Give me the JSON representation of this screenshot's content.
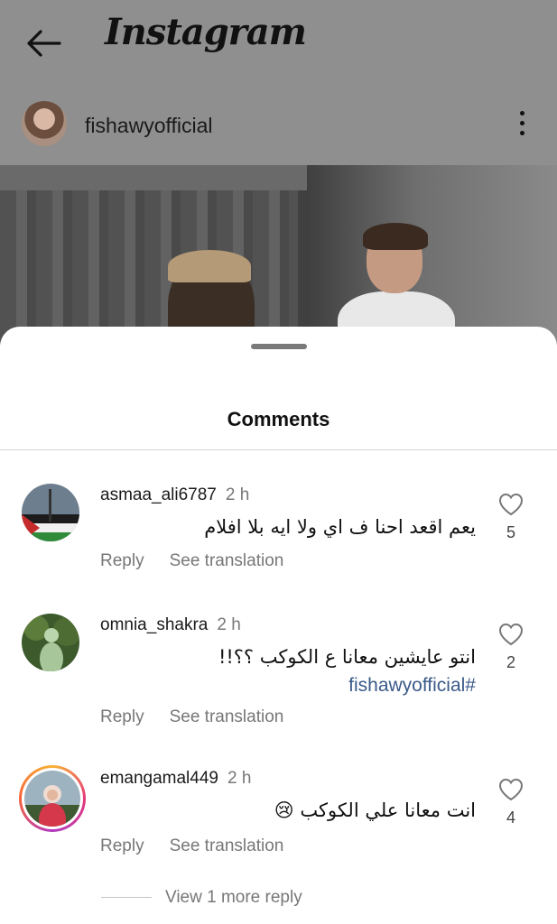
{
  "app": {
    "title": "Instagram"
  },
  "post": {
    "username": "fishawyofficial"
  },
  "sheet": {
    "title": "Comments"
  },
  "comments": [
    {
      "username": "asmaa_ali6787",
      "time": "2 h",
      "text": "يعم اقعد احنا ف اي ولا ايه بلا افلام",
      "tag": "",
      "likes": "5",
      "reply": "Reply",
      "translate": "See translation"
    },
    {
      "username": "omnia_shakra",
      "time": "2 h",
      "text": "انتو عايشين معانا ع الكوكب ؟؟!!",
      "tag": "fishawyofficial#",
      "likes": "2",
      "reply": "Reply",
      "translate": "See translation"
    },
    {
      "username": "emangamal449",
      "time": "2 h",
      "text": "انت معانا علي الكوكب 😢",
      "tag": "",
      "likes": "4",
      "reply": "Reply",
      "translate": "See translation"
    }
  ],
  "view_more": "View 1 more reply",
  "icons": [
    "back-arrow-icon",
    "more-options-icon",
    "heart-icon"
  ],
  "colors": {
    "hashtag": "#3b5a8a",
    "muted": "#777777"
  }
}
